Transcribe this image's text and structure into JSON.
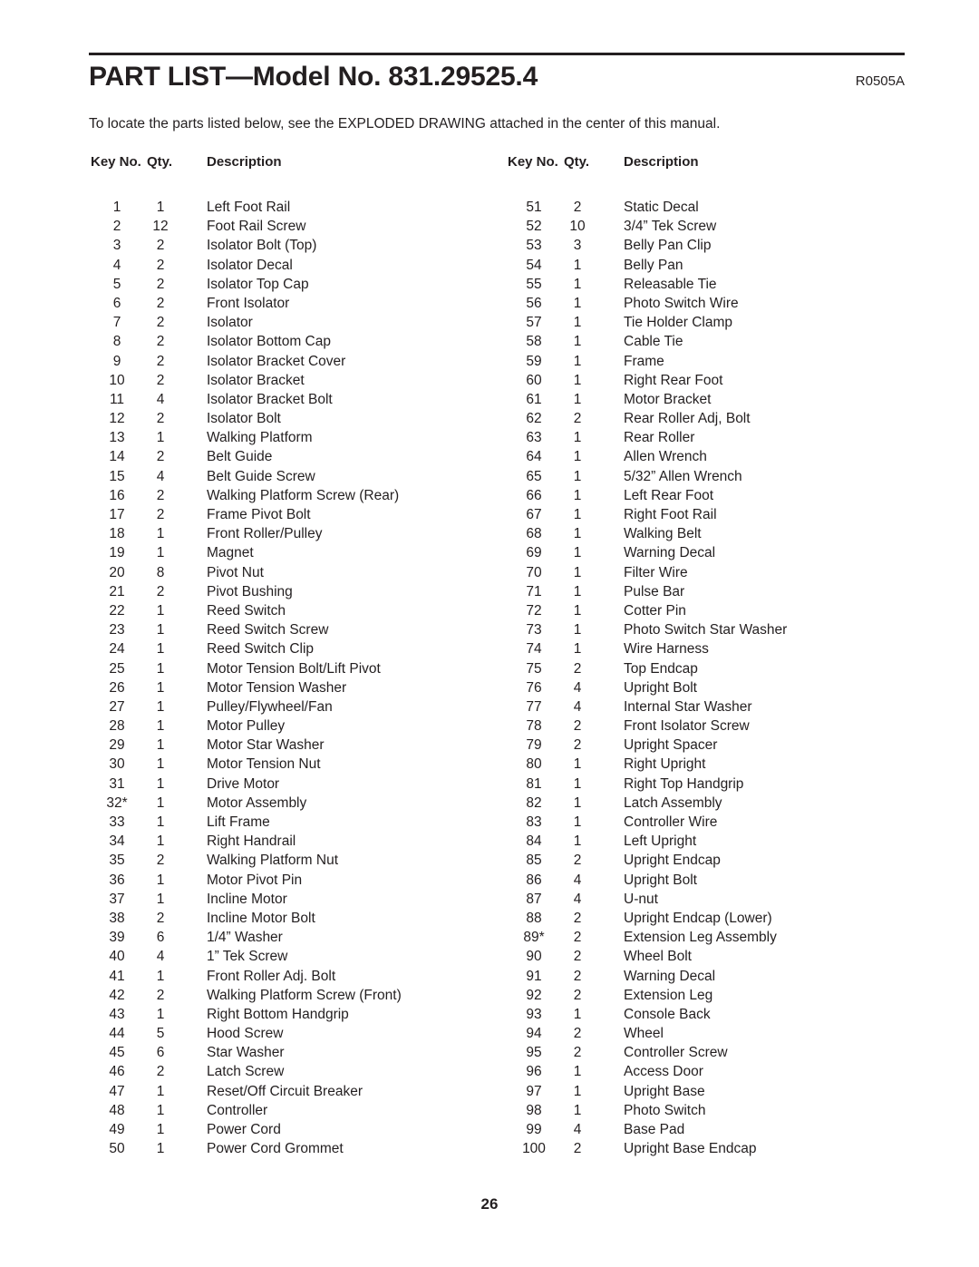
{
  "document": {
    "title": "PART LIST—Model No. 831.29525.4",
    "revision_code": "R0505A",
    "intro": "To locate the parts listed below, see the EXPLODED DRAWING attached in the center of this manual.",
    "page_number": "26"
  },
  "table": {
    "headers": {
      "key_no": "Key No.",
      "qty": "Qty.",
      "description": "Description"
    },
    "left_column": [
      {
        "key": "1",
        "qty": "1",
        "desc": "Left Foot Rail"
      },
      {
        "key": "2",
        "qty": "12",
        "desc": "Foot Rail Screw"
      },
      {
        "key": "3",
        "qty": "2",
        "desc": "Isolator Bolt (Top)"
      },
      {
        "key": "4",
        "qty": "2",
        "desc": "Isolator Decal"
      },
      {
        "key": "5",
        "qty": "2",
        "desc": "Isolator Top Cap"
      },
      {
        "key": "6",
        "qty": "2",
        "desc": "Front Isolator"
      },
      {
        "key": "7",
        "qty": "2",
        "desc": "Isolator"
      },
      {
        "key": "8",
        "qty": "2",
        "desc": "Isolator Bottom Cap"
      },
      {
        "key": "9",
        "qty": "2",
        "desc": "Isolator Bracket Cover"
      },
      {
        "key": "10",
        "qty": "2",
        "desc": "Isolator Bracket"
      },
      {
        "key": "11",
        "qty": "4",
        "desc": "Isolator Bracket Bolt"
      },
      {
        "key": "12",
        "qty": "2",
        "desc": "Isolator Bolt"
      },
      {
        "key": "13",
        "qty": "1",
        "desc": "Walking Platform"
      },
      {
        "key": "14",
        "qty": "2",
        "desc": "Belt Guide"
      },
      {
        "key": "15",
        "qty": "4",
        "desc": "Belt Guide Screw"
      },
      {
        "key": "16",
        "qty": "2",
        "desc": "Walking Platform Screw (Rear)"
      },
      {
        "key": "17",
        "qty": "2",
        "desc": "Frame Pivot Bolt"
      },
      {
        "key": "18",
        "qty": "1",
        "desc": "Front Roller/Pulley"
      },
      {
        "key": "19",
        "qty": "1",
        "desc": "Magnet"
      },
      {
        "key": "20",
        "qty": "8",
        "desc": "Pivot Nut"
      },
      {
        "key": "21",
        "qty": "2",
        "desc": "Pivot Bushing"
      },
      {
        "key": "22",
        "qty": "1",
        "desc": "Reed Switch"
      },
      {
        "key": "23",
        "qty": "1",
        "desc": "Reed Switch Screw"
      },
      {
        "key": "24",
        "qty": "1",
        "desc": "Reed Switch Clip"
      },
      {
        "key": "25",
        "qty": "1",
        "desc": "Motor Tension Bolt/Lift Pivot"
      },
      {
        "key": "26",
        "qty": "1",
        "desc": "Motor Tension Washer"
      },
      {
        "key": "27",
        "qty": "1",
        "desc": "Pulley/Flywheel/Fan"
      },
      {
        "key": "28",
        "qty": "1",
        "desc": "Motor Pulley"
      },
      {
        "key": "29",
        "qty": "1",
        "desc": "Motor Star Washer"
      },
      {
        "key": "30",
        "qty": "1",
        "desc": "Motor Tension Nut"
      },
      {
        "key": "31",
        "qty": "1",
        "desc": "Drive Motor"
      },
      {
        "key": "32*",
        "qty": "1",
        "desc": "Motor Assembly"
      },
      {
        "key": "33",
        "qty": "1",
        "desc": "Lift Frame"
      },
      {
        "key": "34",
        "qty": "1",
        "desc": "Right Handrail"
      },
      {
        "key": "35",
        "qty": "2",
        "desc": "Walking Platform Nut"
      },
      {
        "key": "36",
        "qty": "1",
        "desc": "Motor Pivot Pin"
      },
      {
        "key": "37",
        "qty": "1",
        "desc": "Incline Motor"
      },
      {
        "key": "38",
        "qty": "2",
        "desc": "Incline Motor Bolt"
      },
      {
        "key": "39",
        "qty": "6",
        "desc": "1/4” Washer"
      },
      {
        "key": "40",
        "qty": "4",
        "desc": "1” Tek Screw"
      },
      {
        "key": "41",
        "qty": "1",
        "desc": "Front Roller Adj. Bolt"
      },
      {
        "key": "42",
        "qty": "2",
        "desc": "Walking Platform Screw (Front)"
      },
      {
        "key": "43",
        "qty": "1",
        "desc": "Right Bottom Handgrip"
      },
      {
        "key": "44",
        "qty": "5",
        "desc": "Hood Screw"
      },
      {
        "key": "45",
        "qty": "6",
        "desc": "Star Washer"
      },
      {
        "key": "46",
        "qty": "2",
        "desc": "Latch Screw"
      },
      {
        "key": "47",
        "qty": "1",
        "desc": "Reset/Off Circuit Breaker"
      },
      {
        "key": "48",
        "qty": "1",
        "desc": "Controller"
      },
      {
        "key": "49",
        "qty": "1",
        "desc": "Power Cord"
      },
      {
        "key": "50",
        "qty": "1",
        "desc": "Power Cord Grommet"
      }
    ],
    "right_column": [
      {
        "key": "51",
        "qty": "2",
        "desc": "Static Decal"
      },
      {
        "key": "52",
        "qty": "10",
        "desc": "3/4” Tek Screw"
      },
      {
        "key": "53",
        "qty": "3",
        "desc": "Belly Pan Clip"
      },
      {
        "key": "54",
        "qty": "1",
        "desc": "Belly Pan"
      },
      {
        "key": "55",
        "qty": "1",
        "desc": "Releasable Tie"
      },
      {
        "key": "56",
        "qty": "1",
        "desc": "Photo Switch Wire"
      },
      {
        "key": "57",
        "qty": "1",
        "desc": "Tie Holder Clamp"
      },
      {
        "key": "58",
        "qty": "1",
        "desc": "Cable Tie"
      },
      {
        "key": "59",
        "qty": "1",
        "desc": "Frame"
      },
      {
        "key": "60",
        "qty": "1",
        "desc": "Right Rear Foot"
      },
      {
        "key": "61",
        "qty": "1",
        "desc": "Motor Bracket"
      },
      {
        "key": "62",
        "qty": "2",
        "desc": "Rear Roller Adj, Bolt"
      },
      {
        "key": "63",
        "qty": "1",
        "desc": "Rear Roller"
      },
      {
        "key": "64",
        "qty": "1",
        "desc": "Allen Wrench"
      },
      {
        "key": "65",
        "qty": "1",
        "desc": "5/32” Allen Wrench"
      },
      {
        "key": "66",
        "qty": "1",
        "desc": "Left Rear Foot"
      },
      {
        "key": "67",
        "qty": "1",
        "desc": "Right Foot Rail"
      },
      {
        "key": "68",
        "qty": "1",
        "desc": "Walking Belt"
      },
      {
        "key": "69",
        "qty": "1",
        "desc": "Warning Decal"
      },
      {
        "key": "70",
        "qty": "1",
        "desc": "Filter Wire"
      },
      {
        "key": "71",
        "qty": "1",
        "desc": "Pulse Bar"
      },
      {
        "key": "72",
        "qty": "1",
        "desc": "Cotter Pin"
      },
      {
        "key": "73",
        "qty": "1",
        "desc": "Photo Switch Star Washer"
      },
      {
        "key": "74",
        "qty": "1",
        "desc": "Wire Harness"
      },
      {
        "key": "75",
        "qty": "2",
        "desc": "Top Endcap"
      },
      {
        "key": "76",
        "qty": "4",
        "desc": "Upright Bolt"
      },
      {
        "key": "77",
        "qty": "4",
        "desc": "Internal Star Washer"
      },
      {
        "key": "78",
        "qty": "2",
        "desc": "Front Isolator Screw"
      },
      {
        "key": "79",
        "qty": "2",
        "desc": "Upright Spacer"
      },
      {
        "key": "80",
        "qty": "1",
        "desc": "Right Upright"
      },
      {
        "key": "81",
        "qty": "1",
        "desc": "Right Top Handgrip"
      },
      {
        "key": "82",
        "qty": "1",
        "desc": "Latch Assembly"
      },
      {
        "key": "83",
        "qty": "1",
        "desc": "Controller Wire"
      },
      {
        "key": "84",
        "qty": "1",
        "desc": "Left Upright"
      },
      {
        "key": "85",
        "qty": "2",
        "desc": "Upright Endcap"
      },
      {
        "key": "86",
        "qty": "4",
        "desc": "Upright Bolt"
      },
      {
        "key": "87",
        "qty": "4",
        "desc": "U-nut"
      },
      {
        "key": "88",
        "qty": "2",
        "desc": "Upright Endcap (Lower)"
      },
      {
        "key": "89*",
        "qty": "2",
        "desc": "Extension Leg Assembly"
      },
      {
        "key": "90",
        "qty": "2",
        "desc": "Wheel Bolt"
      },
      {
        "key": "91",
        "qty": "2",
        "desc": "Warning Decal"
      },
      {
        "key": "92",
        "qty": "2",
        "desc": "Extension Leg"
      },
      {
        "key": "93",
        "qty": "1",
        "desc": "Console Back"
      },
      {
        "key": "94",
        "qty": "2",
        "desc": "Wheel"
      },
      {
        "key": "95",
        "qty": "2",
        "desc": "Controller Screw"
      },
      {
        "key": "96",
        "qty": "1",
        "desc": "Access Door"
      },
      {
        "key": "97",
        "qty": "1",
        "desc": "Upright Base"
      },
      {
        "key": "98",
        "qty": "1",
        "desc": "Photo Switch"
      },
      {
        "key": "99",
        "qty": "4",
        "desc": "Base Pad"
      },
      {
        "key": "100",
        "qty": "2",
        "desc": "Upright Base Endcap"
      }
    ]
  }
}
